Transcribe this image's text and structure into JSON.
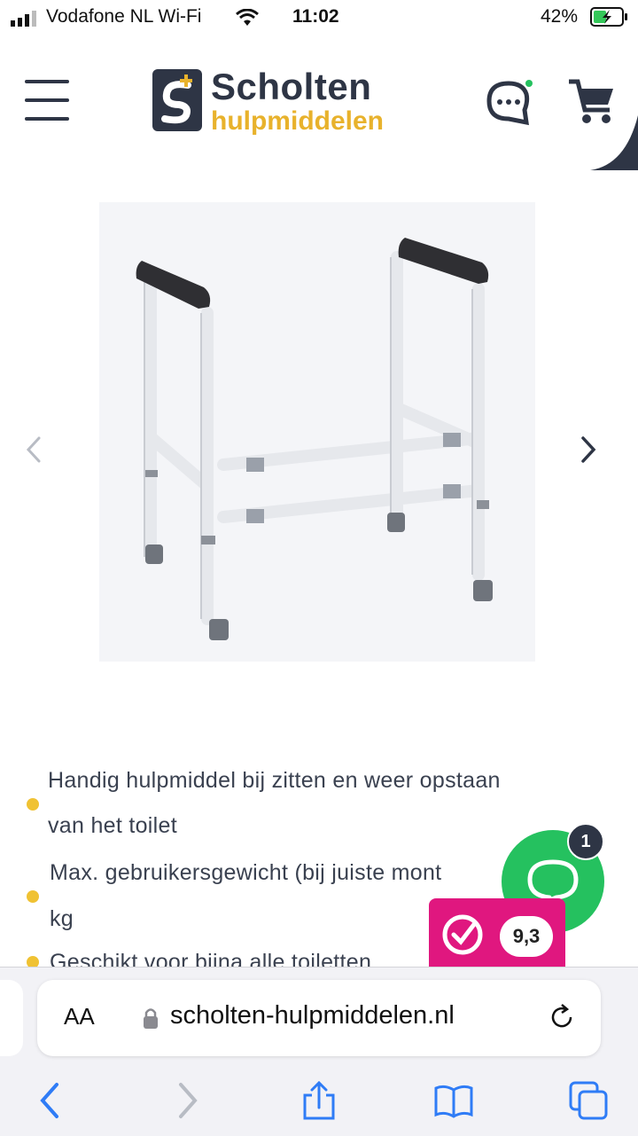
{
  "status_bar": {
    "carrier": "Vodafone NL Wi-Fi",
    "time": "11:02",
    "battery": "42%"
  },
  "header": {
    "logo_top": "Scholten",
    "logo_bottom": "hulpmiddelen",
    "menu_icon": "hamburger-icon",
    "chat_icon": "chat-icon",
    "cart_icon": "cart-icon"
  },
  "gallery": {
    "image_alt": "toilet-frame-product-photo",
    "prev_icon": "chevron-left-icon",
    "next_icon": "chevron-right-icon"
  },
  "features": {
    "item1_line1": "Handig hulpmiddel bij zitten en weer opstaan",
    "item1_line2": "van het toilet",
    "item2_line1": "Max. gebruikersgewicht (bij juiste mont",
    "item2_line2": "kg",
    "item3_line1": "Geschikt voor bijna alle toiletten"
  },
  "chat_widget": {
    "badge_count": "1"
  },
  "rating_widget": {
    "score": "9,3"
  },
  "browser": {
    "aa_label": "AA",
    "url": "scholten-hulpmiddelen.nl"
  },
  "colors": {
    "brand_dark": "#2e3545",
    "brand_yellow": "#e8b22c",
    "chat_green": "#25c15f",
    "rating_pink": "#e0177f",
    "ios_blue": "#2f7cf6"
  }
}
